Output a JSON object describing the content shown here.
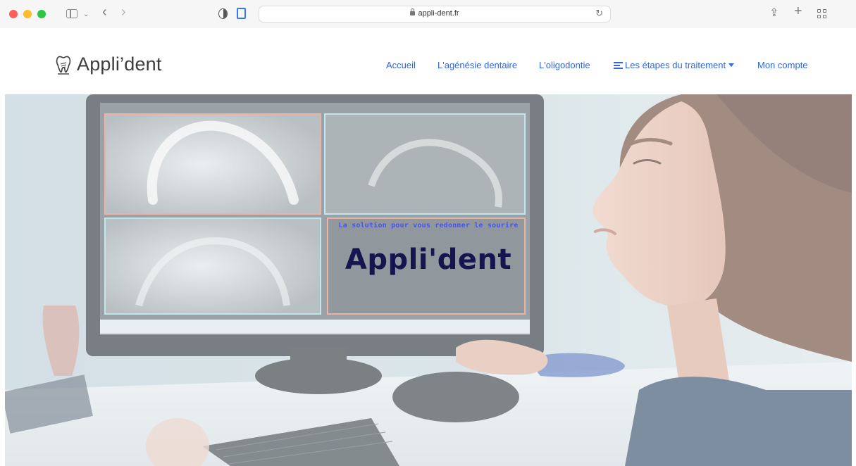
{
  "browser": {
    "url": "appli-dent.fr"
  },
  "site": {
    "logo_text": "Appli’dent",
    "nav": {
      "accueil": "Accueil",
      "agenesie": "L'agénésie dentaire",
      "oligodontie": "L'oligodontie",
      "etapes": "Les étapes du traitement",
      "compte": "Mon compte"
    },
    "accent_color": "#2f66d6"
  },
  "hero": {
    "subtitle": "La solution pour vous redonner le sourire",
    "title": "Appli'dent",
    "title_color": "#16154f",
    "subtitle_color": "#4a55e0"
  }
}
